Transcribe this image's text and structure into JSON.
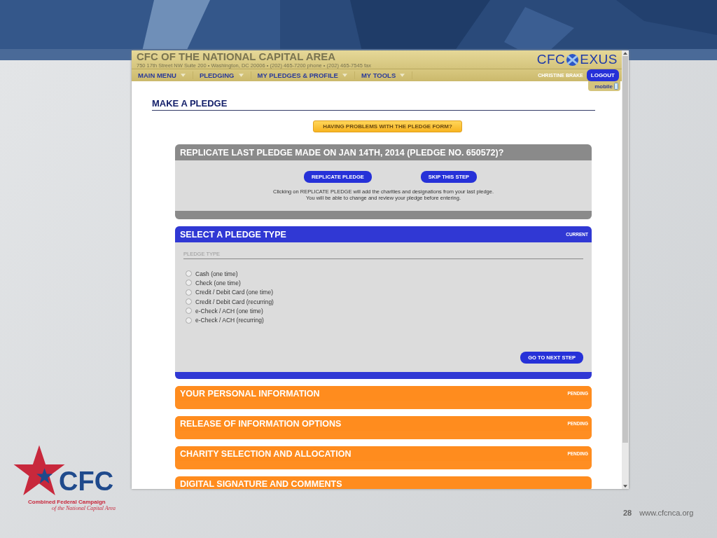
{
  "site_header": {
    "title": "CFC OF THE NATIONAL CAPITAL AREA",
    "address": "750 17th Street NW Suite 200 • Washington, DC 20006 • (202) 465-7200 phone • (202) 465-7545 fax",
    "logo_left": "CFC",
    "logo_right": "EXUS"
  },
  "nav": {
    "items": [
      {
        "label": "MAIN MENU"
      },
      {
        "label": "PLEDGING"
      },
      {
        "label": "MY PLEDGES & PROFILE"
      },
      {
        "label": "MY TOOLS"
      }
    ],
    "user": "CHRISTINE BRAKE",
    "logout": "LOGOUT",
    "mobile": "mobile"
  },
  "page_title": "MAKE A PLEDGE",
  "help_button": "HAVING PROBLEMS WITH THE PLEDGE FORM?",
  "replicate_panel": {
    "title": "REPLICATE LAST PLEDGE MADE ON JAN 14TH, 2014 (PLEDGE NO. 650572)?",
    "buttons": [
      "REPLICATE PLEDGE",
      "SKIP THIS STEP"
    ],
    "note": [
      "Clicking on REPLICATE PLEDGE will add the charities and designations from your last pledge.",
      "You will be able to change and review your pledge before entering."
    ]
  },
  "steps": [
    {
      "title": "SELECT A PLEDGE TYPE",
      "status": "CURRENT",
      "color": "#3038d4",
      "field_label": "PLEDGE TYPE",
      "options": [
        {
          "label": "Cash (one time)",
          "selected": false
        },
        {
          "label": "Check (one time)",
          "selected": false
        },
        {
          "label": "Credit / Debit Card (one time)",
          "selected": false
        },
        {
          "label": "Credit / Debit Card (recurring)",
          "selected": false
        },
        {
          "label": "e-Check / ACH (one time)",
          "selected": false
        },
        {
          "label": "e-Check / ACH (recurring)",
          "selected": false
        }
      ],
      "next_button": "GO TO NEXT STEP"
    },
    {
      "title": "YOUR PERSONAL INFORMATION",
      "status": "PENDING",
      "color": "#ff8c1e"
    },
    {
      "title": "RELEASE OF INFORMATION OPTIONS",
      "status": "PENDING",
      "color": "#ff8c1e"
    },
    {
      "title": "CHARITY SELECTION AND ALLOCATION",
      "status": "PENDING",
      "color": "#ff8c1e"
    },
    {
      "title": "DIGITAL SIGNATURE AND COMMENTS",
      "color": "#ff8c1e"
    }
  ],
  "slide_logo": {
    "mark": "CFC",
    "name": "Combined Federal Campaign",
    "subtitle": "of the National Capital Area"
  },
  "slide_number": "28",
  "slide_url": "www.cfcnca.org"
}
